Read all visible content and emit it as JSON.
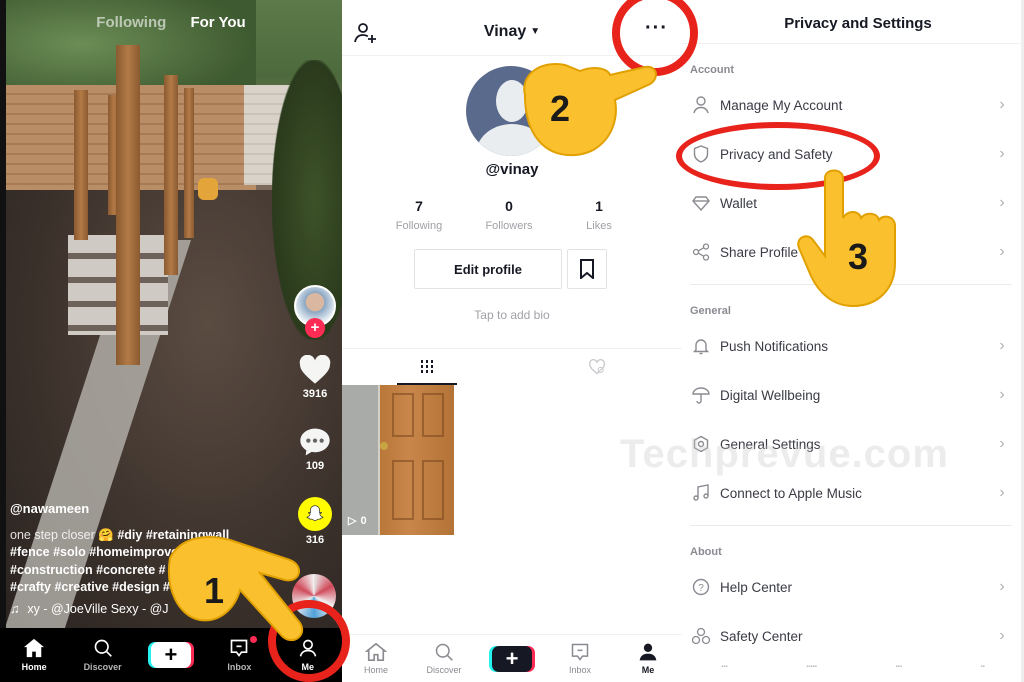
{
  "feed": {
    "top_tabs": [
      {
        "label": "Following",
        "active": false
      },
      {
        "label": "For You",
        "active": true
      }
    ],
    "actions": {
      "likes": "3916",
      "comments": "109",
      "shares": "316"
    },
    "caption": {
      "username": "@nawameen",
      "lead_text": "one step closer",
      "emoji": "🤗",
      "lines": [
        "#diy #retainingwall",
        "#fence #solo #homeimprove",
        "#construction #concrete #",
        "#crafty #creative #design #"
      ],
      "music": "xy - @JoeVille   Sexy - @J"
    },
    "tabbar": [
      {
        "label": "Home",
        "icon": "home-icon",
        "active": false
      },
      {
        "label": "Discover",
        "icon": "search-icon",
        "active": false
      },
      {
        "label": "+",
        "icon": "create-icon",
        "active": false
      },
      {
        "label": "Inbox",
        "icon": "inbox-icon",
        "active": false,
        "badge": true
      },
      {
        "label": "Me",
        "icon": "profile-icon",
        "active": true
      }
    ]
  },
  "profile": {
    "name": "Vinay",
    "handle": "@vinay",
    "more_label": "···",
    "stats": [
      {
        "value": "7",
        "label": "Following"
      },
      {
        "value": "0",
        "label": "Followers"
      },
      {
        "value": "1",
        "label": "Likes"
      }
    ],
    "edit_label": "Edit profile",
    "bio_placeholder": "Tap to add bio",
    "video_views": "0",
    "tabbar": [
      {
        "label": "Home",
        "active": false
      },
      {
        "label": "Discover",
        "active": false
      },
      {
        "label": "+",
        "active": false
      },
      {
        "label": "Inbox",
        "active": false
      },
      {
        "label": "Me",
        "active": true
      }
    ]
  },
  "settings": {
    "title": "Privacy and Settings",
    "sections": [
      {
        "title": "Account",
        "items": [
          {
            "label": "Manage My Account",
            "icon": "user-icon"
          },
          {
            "label": "Privacy and Safety",
            "icon": "shield-icon"
          },
          {
            "label": "Wallet",
            "icon": "diamond-icon"
          },
          {
            "label": "Share Profile",
            "icon": "share-icon"
          }
        ]
      },
      {
        "title": "General",
        "items": [
          {
            "label": "Push Notifications",
            "icon": "bell-icon"
          },
          {
            "label": "Digital Wellbeing",
            "icon": "umbrella-icon"
          },
          {
            "label": "General Settings",
            "icon": "gear-icon"
          },
          {
            "label": "Connect to Apple Music",
            "icon": "music-note-icon"
          }
        ]
      },
      {
        "title": "About",
        "items": [
          {
            "label": "Help Center",
            "icon": "help-icon"
          },
          {
            "label": "Safety Center",
            "icon": "safety-center-icon"
          }
        ]
      }
    ]
  },
  "annotations": {
    "steps": [
      "1",
      "2",
      "3"
    ],
    "highlight_color": "#e8231b",
    "hand_color": "#fbc02d"
  },
  "watermark": "Techprevue.com",
  "colors": {
    "tiktok_red": "#fe2c55",
    "tiktok_cyan": "#25f4ee",
    "text_dark": "#161823",
    "text_muted": "#a0a1a6"
  }
}
